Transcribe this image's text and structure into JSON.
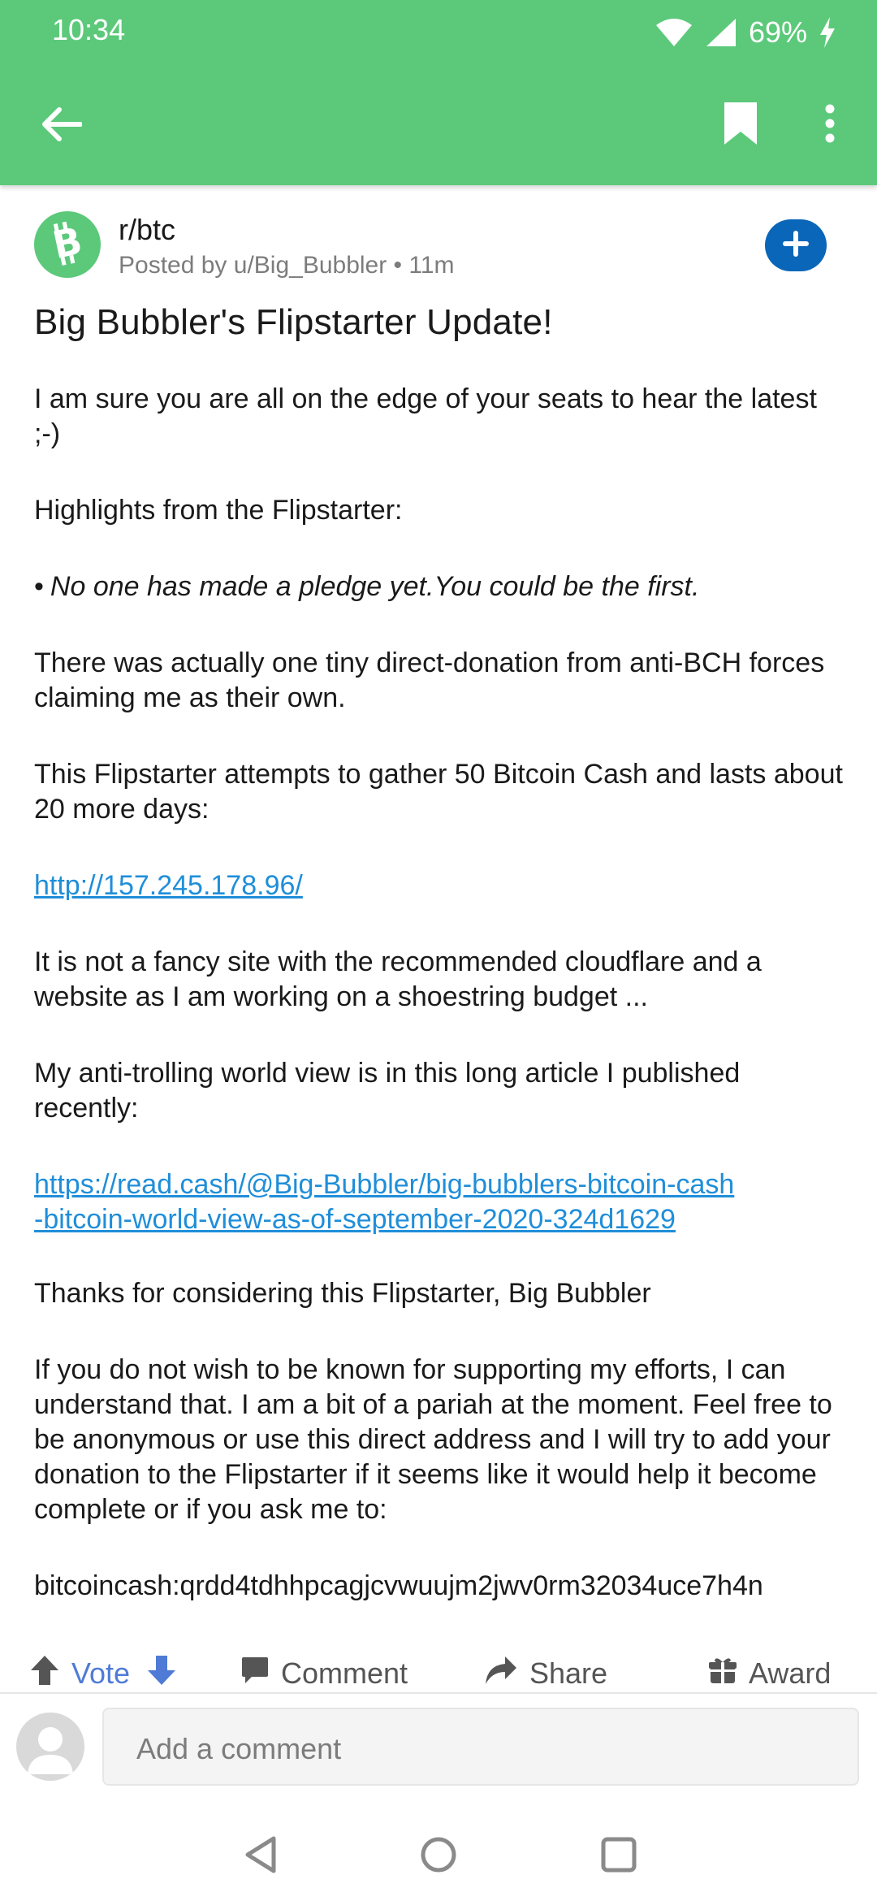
{
  "status": {
    "time": "10:34",
    "battery": "69%"
  },
  "colors": {
    "app_bar": "#5cc97a",
    "link": "#1f8ed9",
    "join_button": "#0a66b8",
    "vote_blue": "#4f7bd6"
  },
  "icons": {
    "back": "arrow-left-icon",
    "bookmark": "bookmark-icon",
    "more": "more-vertical-icon",
    "subreddit": "bitcoin-cash-icon",
    "join": "plus-icon",
    "upvote": "arrow-up-icon",
    "downvote": "arrow-down-icon",
    "comment": "comment-icon",
    "share": "share-icon",
    "award": "gift-icon",
    "user": "user-avatar-icon"
  },
  "post": {
    "subreddit": "r/btc",
    "posted_by": "Posted by u/Big_Bubbler • 11m",
    "title": "Big Bubbler's Flipstarter Update!",
    "paragraphs": {
      "p1": "I am sure you are all on the edge of your seats to hear the latest ;-)",
      "p2": "Highlights from the Flipstarter:",
      "bullet_dot": "•",
      "p3": "No one has made a pledge yet.You could be the first.",
      "p4": "There was actually one tiny direct-donation from anti-BCH forces claiming me as their own.",
      "p5": "This Flipstarter attempts to gather 50 Bitcoin Cash and lasts about 20 more days:",
      "link1": "http://157.245.178.96/",
      "p6": "It is not a fancy site with the recommended cloudflare and a website  as I am working on a shoestring budget ...",
      "p7": "My anti-trolling world view is in this long article I published recently:",
      "link2": "https://read.cash/@Big-Bubbler/big-bubblers-bitcoin-cash-bitcoin-world-view-as-of-september-2020-324d1629",
      "p8": "Thanks for considering this Flipstarter,  Big Bubbler",
      "p9": "If you do not wish to be known for supporting my efforts, I can understand that. I am a bit of a pariah at the moment. Feel free to be  anonymous or use this direct address and I will try to add your donation to the Flipstarter if it seems like it would help it become complete or if you ask me to:",
      "address": "bitcoincash:qrdd4tdhhpcagjcvwuujm2jwv0rm32034uce7h4n"
    }
  },
  "actions": {
    "vote": "Vote",
    "comment": "Comment",
    "share": "Share",
    "award": "Award"
  },
  "comment_bar": {
    "placeholder": "Add a comment"
  }
}
